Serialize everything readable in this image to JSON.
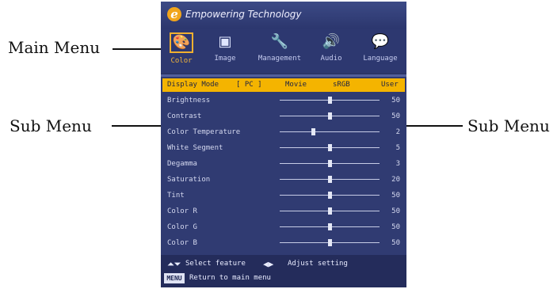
{
  "callouts": {
    "main_menu": "Main Menu",
    "sub_menu_left": "Sub Menu",
    "sub_menu_right": "Sub Menu"
  },
  "header": {
    "logo_letter": "e",
    "brand": "Empowering Technology"
  },
  "tabs": [
    {
      "label": "Color",
      "icon": "color-palette-icon",
      "glyph": "🎨"
    },
    {
      "label": "Image",
      "icon": "image-icon",
      "glyph": "▣"
    },
    {
      "label": "Management",
      "icon": "wrench-icon",
      "glyph": "🔧"
    },
    {
      "label": "Audio",
      "icon": "speaker-icon",
      "glyph": "🔊"
    },
    {
      "label": "Language",
      "icon": "language-icon",
      "glyph": "💬"
    }
  ],
  "display_mode": {
    "label": "Display Mode",
    "input": "[ PC ]",
    "options": [
      "Movie",
      "sRGB",
      "User"
    ]
  },
  "settings": [
    {
      "name": "Brightness",
      "value": "50",
      "level": 0.5
    },
    {
      "name": "Contrast",
      "value": "50",
      "level": 0.5
    },
    {
      "name": "Color Temperature",
      "value": "2",
      "level": 0.33
    },
    {
      "name": "White Segment",
      "value": "5",
      "level": 0.5
    },
    {
      "name": "Degamma",
      "value": "3",
      "level": 0.5
    },
    {
      "name": "Saturation",
      "value": "20",
      "level": 0.5
    },
    {
      "name": "Tint",
      "value": "50",
      "level": 0.5
    },
    {
      "name": "Color R",
      "value": "50",
      "level": 0.5
    },
    {
      "name": "Color G",
      "value": "50",
      "level": 0.5
    },
    {
      "name": "Color B",
      "value": "50",
      "level": 0.5
    }
  ],
  "footer": {
    "select": "Select feature",
    "adjust": "Adjust setting",
    "menu_key": "MENU",
    "return": "Return to main menu"
  },
  "colors": {
    "highlight": "#f4b400",
    "panel": "#303b72",
    "header": "#2c376e"
  }
}
